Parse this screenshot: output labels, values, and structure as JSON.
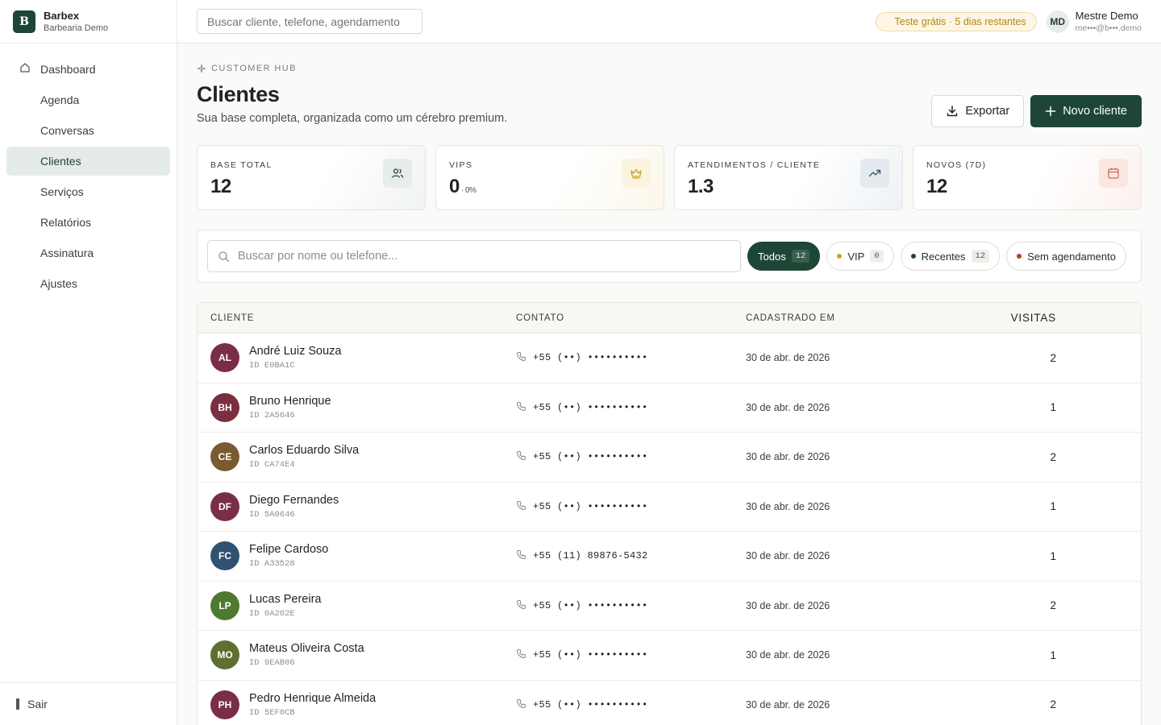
{
  "brand": {
    "logo_letter": "B",
    "name": "Barbex",
    "subtitle": "Barbearia Demo"
  },
  "sidebar": {
    "items": [
      {
        "label": "Dashboard",
        "icon": "home-icon",
        "active": false
      },
      {
        "label": "Agenda",
        "active": false
      },
      {
        "label": "Conversas",
        "active": false
      },
      {
        "label": "Clientes",
        "active": true
      },
      {
        "label": "Serviços",
        "active": false
      },
      {
        "label": "Relatórios",
        "active": false
      },
      {
        "label": "Assinatura",
        "active": false
      },
      {
        "label": "Ajustes",
        "active": false
      }
    ],
    "logout_label": "Sair"
  },
  "topbar": {
    "search_placeholder": "Buscar cliente, telefone, agendamento",
    "trial_badge": "Teste grátis · 5 dias restantes",
    "user": {
      "initials": "MD",
      "name": "Mestre Demo",
      "email": "me•••@b•••.demo"
    }
  },
  "page": {
    "eyebrow": "CUSTOMER HUB",
    "title": "Clientes",
    "subtitle": "Sua base completa, organizada como um cérebro premium.",
    "export_label": "Exportar",
    "new_client_label": "Novo cliente"
  },
  "stats": [
    {
      "label": "BASE TOTAL",
      "value": "12",
      "suffix": "",
      "icon": "users-icon",
      "color": "#1e4636",
      "icon_bg": "#e7eee9"
    },
    {
      "label": "VIPS",
      "value": "0",
      "suffix": "· 0%",
      "icon": "crown-icon",
      "color": "#c9a227",
      "icon_bg": "#faf3df"
    },
    {
      "label": "ATENDIMENTOS / CLIENTE",
      "value": "1.3",
      "suffix": "",
      "icon": "trending-up-icon",
      "color": "#3d5a73",
      "icon_bg": "#e4eaef"
    },
    {
      "label": "NOVOS (7D)",
      "value": "12",
      "suffix": "",
      "icon": "calendar-icon",
      "color": "#d2694f",
      "icon_bg": "#fbe7e1"
    }
  ],
  "filters": {
    "search_placeholder": "Buscar por nome ou telefone...",
    "pills": [
      {
        "label": "Todos",
        "count": "12",
        "active": true,
        "dot": ""
      },
      {
        "label": "VIP",
        "count": "0",
        "active": false,
        "dot": "#c9a227"
      },
      {
        "label": "Recentes",
        "count": "12",
        "active": false,
        "dot": "#1e4636"
      },
      {
        "label": "Sem agendamento",
        "count": "",
        "active": false,
        "dot": "#c0392b"
      }
    ]
  },
  "table": {
    "headers": {
      "client": "CLIENTE",
      "contact": "CONTATO",
      "date": "CADASTRADO EM",
      "visits": "VISITAS"
    },
    "rows": [
      {
        "initials": "AL",
        "avatar_color": "#7a2e45",
        "name": "André Luiz Souza",
        "id": "ID E0BA1C",
        "phone": "+55 (••) ••••••••••",
        "date": "30 de abr. de 2026",
        "visits": "2"
      },
      {
        "initials": "BH",
        "avatar_color": "#7a2e3e",
        "name": "Bruno Henrique",
        "id": "ID 2A5646",
        "phone": "+55 (••) ••••••••••",
        "date": "30 de abr. de 2026",
        "visits": "1"
      },
      {
        "initials": "CE",
        "avatar_color": "#7a5a30",
        "name": "Carlos Eduardo Silva",
        "id": "ID CA74E4",
        "phone": "+55 (••) ••••••••••",
        "date": "30 de abr. de 2026",
        "visits": "2"
      },
      {
        "initials": "DF",
        "avatar_color": "#7a2e45",
        "name": "Diego Fernandes",
        "id": "ID 5A0646",
        "phone": "+55 (••) ••••••••••",
        "date": "30 de abr. de 2026",
        "visits": "1"
      },
      {
        "initials": "FC",
        "avatar_color": "#2e5270",
        "name": "Felipe Cardoso",
        "id": "ID A33528",
        "phone": "+55 (11) 89876-5432",
        "date": "30 de abr. de 2026",
        "visits": "1"
      },
      {
        "initials": "LP",
        "avatar_color": "#4e7a2e",
        "name": "Lucas Pereira",
        "id": "ID 0A202E",
        "phone": "+55 (••) ••••••••••",
        "date": "30 de abr. de 2026",
        "visits": "2"
      },
      {
        "initials": "MO",
        "avatar_color": "#5e7030",
        "name": "Mateus Oliveira Costa",
        "id": "ID 9EAB06",
        "phone": "+55 (••) ••••••••••",
        "date": "30 de abr. de 2026",
        "visits": "1"
      },
      {
        "initials": "PH",
        "avatar_color": "#7a2e45",
        "name": "Pedro Henrique Almeida",
        "id": "ID 5EF0CB",
        "phone": "+55 (••) ••••••••••",
        "date": "30 de abr. de 2026",
        "visits": "2"
      }
    ]
  }
}
